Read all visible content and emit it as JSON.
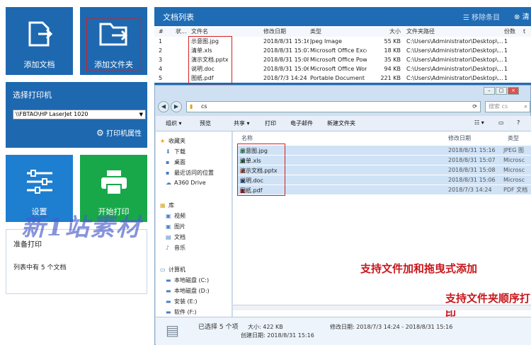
{
  "tiles": {
    "add_doc": "添加文档",
    "add_folder": "添加文件夹",
    "settings": "设置",
    "start_print": "开始打印"
  },
  "printer": {
    "title": "选择打印机",
    "selected": "\\\\FBTAO\\HP LaserJet 1020",
    "properties": "打印机属性"
  },
  "status": {
    "ready": "准备打印",
    "count_text": "列表中有 5 个文档"
  },
  "watermark": "新1站素材",
  "doclist": {
    "title": "文档列表",
    "remove": "移除条目",
    "clear": "清",
    "columns": [
      "#",
      "状...",
      "文件名",
      "修改日期",
      "类型",
      "大小",
      "文件夹路径",
      "份数",
      "t"
    ],
    "rows": [
      {
        "n": "1",
        "name": "示意图.jpg",
        "date": "2018/8/31 15:16",
        "type": "Jpeg Image",
        "size": "55 KB",
        "path": "C:\\Users\\Administrator\\Desktop\\...",
        "copies": "1"
      },
      {
        "n": "2",
        "name": "清单.xls",
        "date": "2018/8/31 15:07",
        "type": "Microsoft Office Excel...",
        "size": "18 KB",
        "path": "C:\\Users\\Administrator\\Desktop\\...",
        "copies": "1"
      },
      {
        "n": "3",
        "name": "演示文档.pptx",
        "date": "2018/8/31 15:08",
        "type": "Microsoft Office Pow...",
        "size": "35 KB",
        "path": "C:\\Users\\Administrator\\Desktop\\...",
        "copies": "1"
      },
      {
        "n": "4",
        "name": "说明.doc",
        "date": "2018/8/31 15:06",
        "type": "Microsoft Office Wor...",
        "size": "94 KB",
        "path": "C:\\Users\\Administrator\\Desktop\\...",
        "copies": "1"
      },
      {
        "n": "5",
        "name": "图纸.pdf",
        "date": "2018/7/3 14:24",
        "type": "Portable Document F...",
        "size": "221 KB",
        "path": "C:\\Users\\Administrator\\Desktop\\...",
        "copies": "1"
      }
    ]
  },
  "explorer": {
    "path": "cs",
    "search_placeholder": "搜索 cs",
    "toolbar": [
      "组织 ▾",
      "预览",
      "共享 ▾",
      "打印",
      "电子邮件",
      "新建文件夹"
    ],
    "sidebar": {
      "favorites": "收藏夹",
      "fav_items": [
        "下载",
        "桌面",
        "最近访问的位置",
        "A360 Drive"
      ],
      "library": "库",
      "lib_items": [
        "视频",
        "图片",
        "文档",
        "音乐"
      ],
      "computer": "计算机",
      "comp_items": [
        "本地磁盘 (C:)",
        "本地磁盘 (D:)",
        "安装 (E:)",
        "软件 (F:)"
      ]
    },
    "columns": {
      "name": "名称",
      "date": "修改日期",
      "type": "类型"
    },
    "files": [
      {
        "name": "示意图.jpg",
        "date": "2018/8/31 15:16",
        "type": "JPEG 图"
      },
      {
        "name": "清单.xls",
        "date": "2018/8/31 15:07",
        "type": "Microsc"
      },
      {
        "name": "演示文档.pptx",
        "date": "2018/8/31 15:08",
        "type": "Microsc"
      },
      {
        "name": "说明.doc",
        "date": "2018/8/31 15:06",
        "type": "Microsc"
      },
      {
        "name": "图纸.pdf",
        "date": "2018/7/3 14:24",
        "type": "PDF 文档"
      }
    ],
    "note1": "支持文件加和拖曳式添加",
    "note2": "支持文件夹顺序打印",
    "details": {
      "selected": "已选择 5 个项",
      "size": "大小: 422 KB",
      "modified": "修改日期: 2018/7/3 14:24 - 2018/8/31 15:16",
      "created": "创建日期: 2018/8/31 15:16"
    }
  },
  "colors": {
    "tile_blue": "#1e68b0",
    "tile_green": "#18a84a",
    "red_note": "#c8161b"
  }
}
